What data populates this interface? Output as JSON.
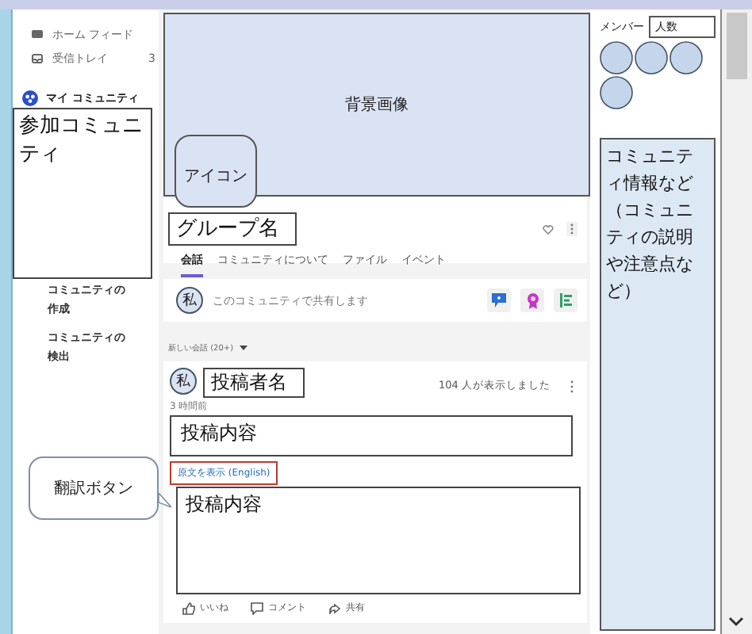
{
  "sidebar": {
    "nav": [
      {
        "kind": "feed",
        "label": "ホーム フィード"
      },
      {
        "kind": "inbox",
        "label": "受信トレイ",
        "count": "3"
      }
    ],
    "section": "マイ コミュニティ",
    "joined_box": "参加コミュニティ",
    "links": [
      "コミュニティの作成",
      "コミュニティの検出"
    ]
  },
  "main": {
    "cover": "背景画像",
    "icon_box": "アイコン",
    "group_name": "グループ名",
    "tabs": [
      {
        "label": "会話",
        "selected": true
      },
      {
        "label": "コミュニティについて",
        "selected": false
      },
      {
        "label": "ファイル",
        "selected": false
      },
      {
        "label": "イベント",
        "selected": false
      }
    ],
    "composer": {
      "avatar": "私",
      "placeholder": "このコミュニティで共有します"
    },
    "feed_filter": "新しい会話 (20+)",
    "post": {
      "avatar": "私",
      "author": "投稿者名",
      "time": "3 時間前",
      "views": "104 人が表示しました",
      "content": "投稿内容",
      "translate_link": "原文を表示 (English)",
      "translated_content": "投稿内容",
      "actions": [
        {
          "kind": "like",
          "label": "いいね"
        },
        {
          "kind": "comment",
          "label": "コメント"
        },
        {
          "kind": "share",
          "label": "共有"
        }
      ]
    }
  },
  "callout": "翻訳ボタン",
  "right": {
    "members_label": "メンバー",
    "member_count": "人数",
    "info": "コミュニティ情報など（コミュニティの説明や注意点など）"
  }
}
